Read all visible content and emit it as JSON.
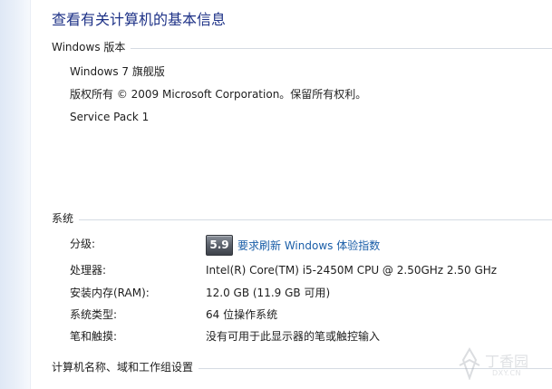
{
  "title": "查看有关计算机的基本信息",
  "windows_edition": {
    "heading": "Windows 版本",
    "edition": "Windows 7 旗舰版",
    "copyright": "版权所有 © 2009 Microsoft Corporation。保留所有权利。",
    "service_pack": "Service Pack 1"
  },
  "system": {
    "heading": "系统",
    "rating_label": "分级:",
    "rating_score": "5.9",
    "rating_link": "要求刷新 Windows 体验指数",
    "processor_label": "处理器:",
    "processor_value": "Intel(R) Core(TM) i5-2450M CPU @ 2.50GHz   2.50 GHz",
    "ram_label": "安装内存(RAM):",
    "ram_value": "12.0 GB (11.9 GB 可用)",
    "type_label": "系统类型:",
    "type_value": "64 位操作系统",
    "pen_label": "笔和触摸:",
    "pen_value": "没有可用于此显示器的笔或触控输入"
  },
  "computer_name": {
    "heading": "计算机名称、域和工作组设置"
  },
  "watermark": {
    "brand": "丁香园",
    "url": "DXY.CN"
  }
}
